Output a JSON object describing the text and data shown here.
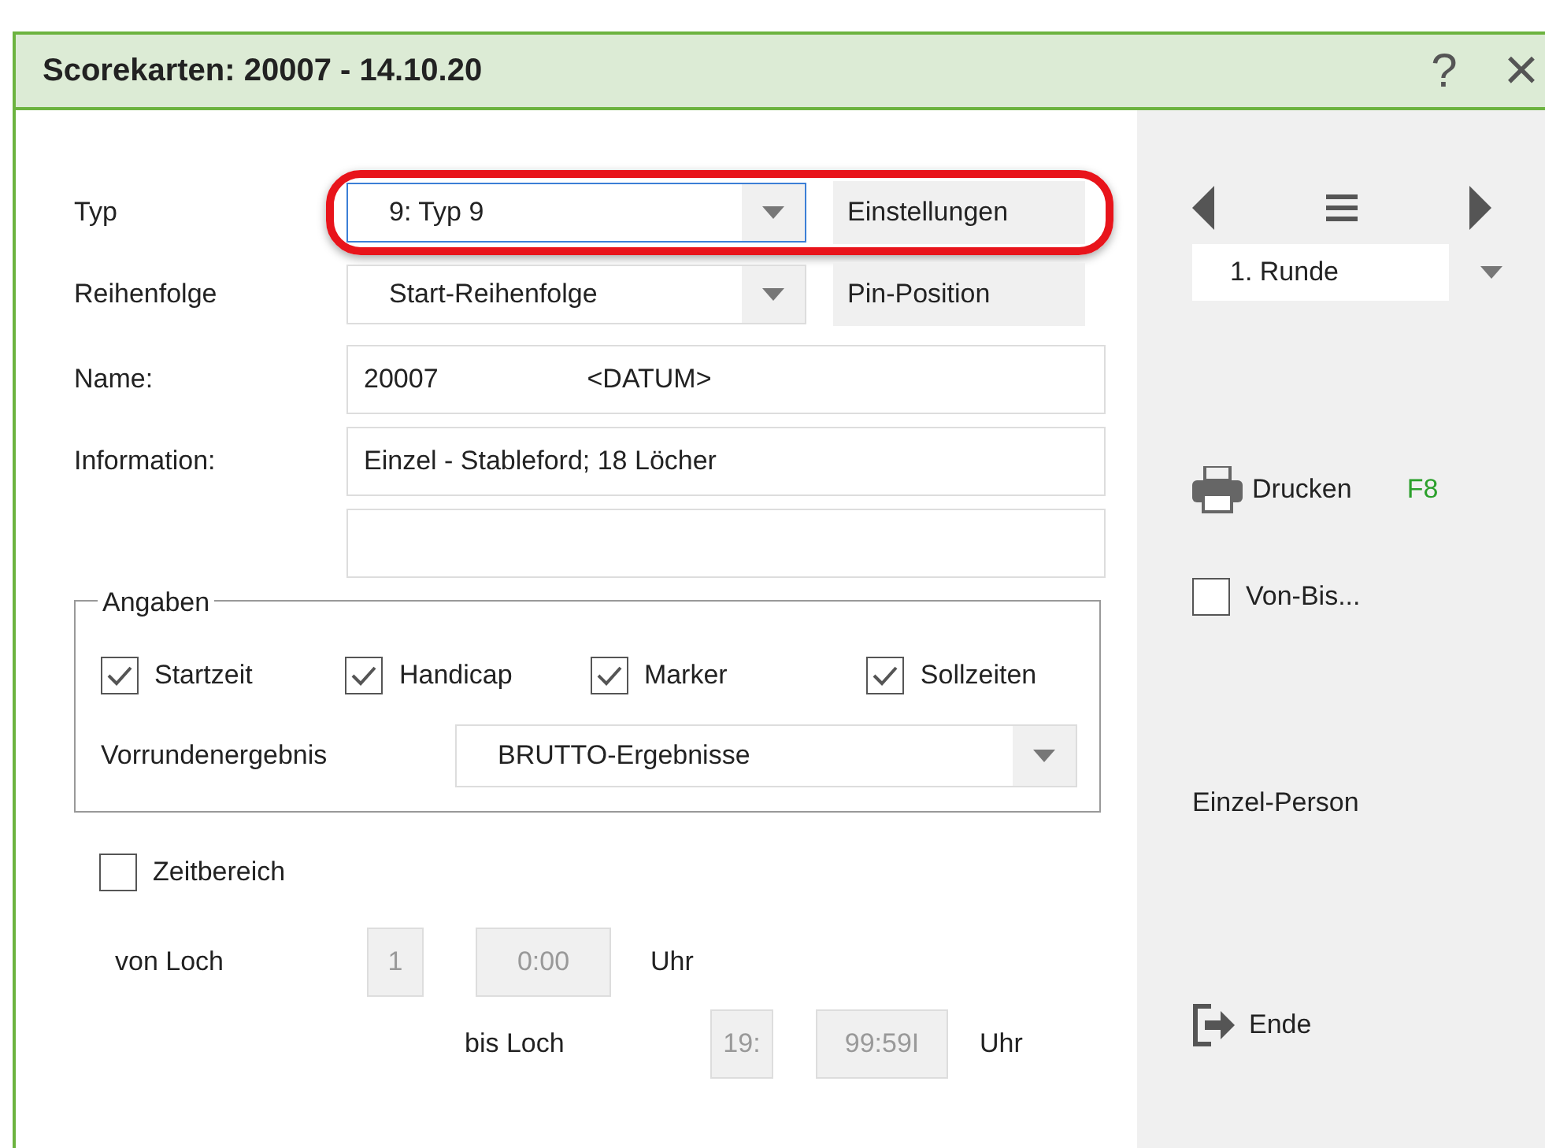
{
  "window": {
    "title": "Scorekarten: 20007 - 14.10.20",
    "help": "?",
    "close": "×"
  },
  "form": {
    "rows": [
      {
        "kind": "combo",
        "label": "Typ",
        "value": "9: Typ 9",
        "focused": true,
        "highlighted": true,
        "button": "Einstellungen"
      },
      {
        "kind": "combo",
        "label": "Reihenfolge",
        "value": "Start-Reihenfolge",
        "focused": false,
        "highlighted": false,
        "button": "Pin-Position"
      },
      {
        "kind": "text",
        "label": "Name:",
        "value": "20007                    <DATUM>"
      },
      {
        "kind": "text",
        "label": "Information:",
        "value": "Einzel - Stableford; 18 Löcher"
      },
      {
        "kind": "text",
        "value": ""
      }
    ]
  },
  "angaben": {
    "title": "Angaben",
    "checkboxes": [
      {
        "label": "Startzeit",
        "checked": true
      },
      {
        "label": "Handicap",
        "checked": true
      },
      {
        "label": "Marker",
        "checked": true
      },
      {
        "label": "Sollzeiten",
        "checked": true
      }
    ],
    "vorrunden_label": "Vorrundenergebnis",
    "vorrunden_value": "BRUTTO-Ergebnisse"
  },
  "zeitbereich": {
    "label": "Zeitbereich",
    "checked": false,
    "from_label": "von Loch",
    "from_hole": "1",
    "from_time": "0:00",
    "from_unit": "Uhr",
    "to_label": "bis Loch",
    "to_hole": "19:",
    "to_time": "99:59I",
    "to_unit": "Uhr"
  },
  "side": {
    "round": "1. Runde",
    "print": "Drucken",
    "print_key": "F8",
    "range": {
      "label": "Von-Bis...",
      "checked": false
    },
    "single": "Einzel-Person",
    "exit": "Ende"
  }
}
